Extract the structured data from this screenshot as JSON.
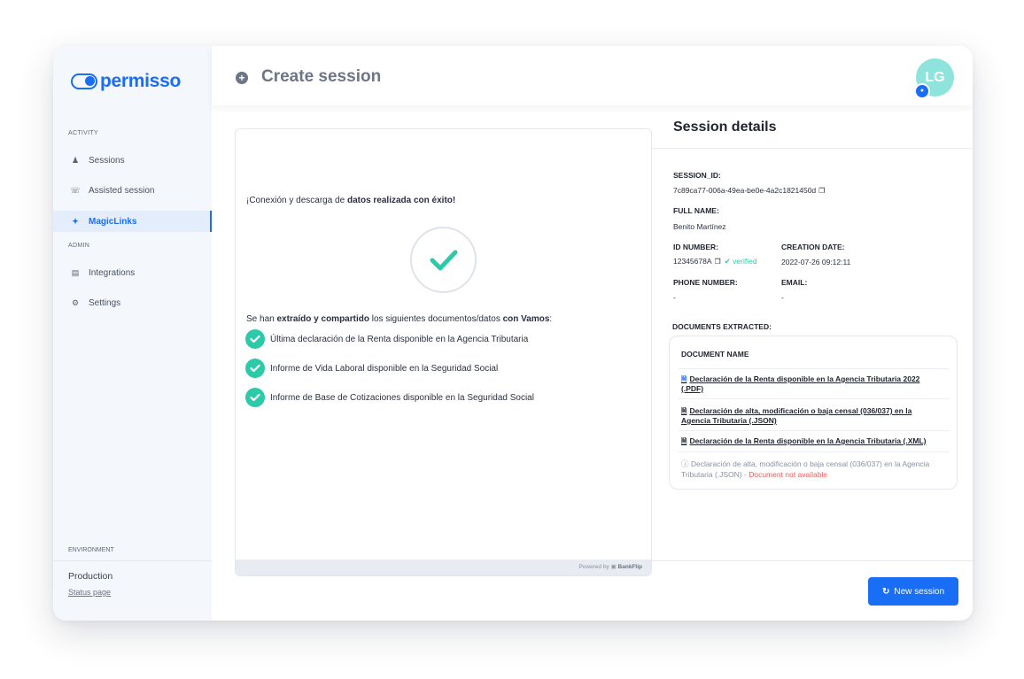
{
  "brand": {
    "name": "permisso",
    "color": "#1a6ef5"
  },
  "sidebar": {
    "activity_label": "ACTIVITY",
    "admin_label": "ADMIN",
    "items": [
      {
        "label": "Sessions",
        "icon": "user-icon"
      },
      {
        "label": "Assisted session",
        "icon": "headset-icon"
      },
      {
        "label": "MagicLinks",
        "icon": "magic-wand-icon",
        "active": true
      },
      {
        "label": "Integrations",
        "icon": "database-icon"
      },
      {
        "label": "Settings",
        "icon": "gear-icon"
      }
    ],
    "environment_label": "ENVIRONMENT",
    "environment_name": "Production",
    "status_link": "Status page"
  },
  "header": {
    "title": "Create session",
    "avatar_initials": "LG"
  },
  "panel": {
    "success_prefix": "¡Conexión y descarga de ",
    "success_bold": "datos realizada con éxito!",
    "shared_prefix": "Se han ",
    "shared_bold": "extraído y compartido",
    "shared_middle": " los siguientes documentos/datos ",
    "shared_bold2": "con Vamos",
    "shared_suffix": ":",
    "items": [
      "Última declaración de la Renta disponible en la Agencia Tributaria",
      "Informe de Vida Laboral disponible en la Seguridad Social",
      "Informe de Base de Cotizaciones disponible en la Seguridad Social"
    ],
    "powered_by": "Powered by",
    "powered_brand": "BankFlip"
  },
  "details": {
    "title": "Session details",
    "session_id_label": "SESSION_ID:",
    "session_id": "7c89ca77-006a-49ea-be0e-4a2c1821450d",
    "full_name_label": "FULL NAME:",
    "full_name": "Benito Martínez",
    "id_number_label": "ID NUMBER:",
    "id_number": "12345678A",
    "verified": "verified",
    "creation_date_label": "CREATION DATE:",
    "creation_date": "2022-07-26 09:12:11",
    "phone_label": "PHONE NUMBER:",
    "phone": "-",
    "email_label": "EMAIL:",
    "email": "-",
    "docs_label": "DOCUMENTS EXTRACTED:",
    "docs_header": "DOCUMENT NAME",
    "documents": [
      "Declaración de la Renta disponible en la Agencia Tributaria 2022 (.PDF)",
      "Declaración de alta, modificación o baja censal (036/037) en la Agencia Tributaria (.JSON)",
      "Declaración de la Renta disponible en la Agencia Tributaria (.XML)"
    ],
    "unavailable_doc": "Declaración de alta, modificación o baja censal (036/037) en la Agencia Tributaria (.JSON) - ",
    "unavailable_status": "Document not available"
  },
  "footer": {
    "new_session_label": "New session"
  }
}
